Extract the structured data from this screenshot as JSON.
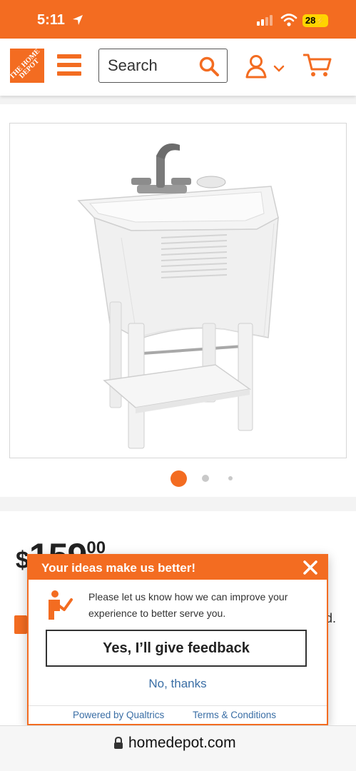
{
  "status_bar": {
    "time": "5:11",
    "battery": "28",
    "icons": [
      "location-arrow-icon",
      "signal-icon",
      "wifi-icon",
      "battery-icon"
    ]
  },
  "header": {
    "logo_text": "THE HOME DEPOT",
    "search_placeholder": "Search",
    "icons": [
      "hamburger-menu-icon",
      "search-icon",
      "account-icon",
      "chevron-down-icon",
      "cart-icon"
    ]
  },
  "gallery": {
    "image_alt": "White freestanding utility laundry sink with faucet and bottom shelf",
    "dot_count": 3,
    "active_dot": 0
  },
  "product": {
    "price_dollar_sign": "$",
    "price_whole": "159",
    "price_cents": "00",
    "partial_text": "d."
  },
  "feedback_dialog": {
    "title": "Your ideas make us better!",
    "message": "Please let us know how we can improve your experience to better serve you.",
    "primary_button": "Yes, I’ll give feedback",
    "secondary_link": "No, thanks",
    "powered_by": "Powered by Qualtrics",
    "terms": "Terms & Conditions"
  },
  "url_bar": {
    "url": "homedepot.com"
  },
  "colors": {
    "brand_orange": "#f36c21",
    "link_blue": "#3a6ea5",
    "battery_yellow": "#ffd400"
  }
}
